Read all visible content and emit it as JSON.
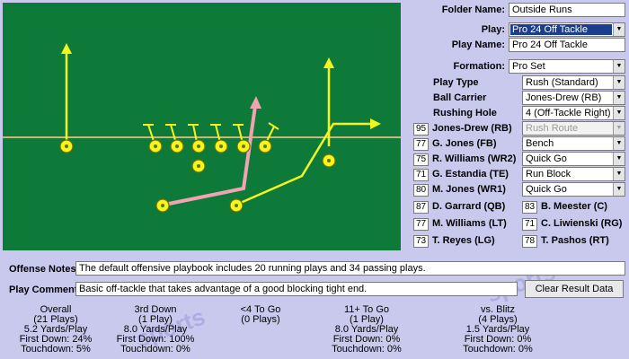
{
  "panel": {
    "folder_name_label": "Folder Name:",
    "folder_name_value": "Outside Runs",
    "play_label": "Play:",
    "play_value": "Pro 24 Off Tackle",
    "play_name_label": "Play Name:",
    "play_name_value": "Pro 24 Off Tackle",
    "formation_label": "Formation:",
    "formation_value": "Pro Set",
    "play_type_label": "Play Type",
    "play_type_value": "Rush (Standard)",
    "ball_carrier_label": "Ball Carrier",
    "ball_carrier_value": "Jones-Drew (RB)",
    "rushing_hole_label": "Rushing Hole",
    "rushing_hole_value": "4 (Off-Tackle Right)",
    "players": [
      {
        "num": "95",
        "name": "Jones-Drew (RB)",
        "assignment": "Rush Route"
      },
      {
        "num": "77",
        "name": "G. Jones (FB)",
        "assignment": "Bench"
      },
      {
        "num": "75",
        "name": "R. Williams (WR2)",
        "assignment": "Quick Go"
      },
      {
        "num": "71",
        "name": "G. Estandia (TE)",
        "assignment": "Run Block"
      },
      {
        "num": "80",
        "name": "M. Jones (WR1)",
        "assignment": "Quick Go"
      }
    ],
    "linemen": [
      {
        "num": "87",
        "name": "D. Garrard (QB)"
      },
      {
        "num": "83",
        "name": "B. Meester (C)"
      },
      {
        "num": "77",
        "name": "M. Williams (LT)"
      },
      {
        "num": "71",
        "name": "C. Liwienski (RG)"
      },
      {
        "num": "73",
        "name": "T. Reyes (LG)"
      },
      {
        "num": "78",
        "name": "T. Pashos (RT)"
      }
    ]
  },
  "notes": {
    "offense_label": "Offense Notes:",
    "offense_text": "The default offensive playbook includes 20 running plays and 34 passing plays.",
    "comment_label": "Play Comment:",
    "comment_text": "Basic off-tackle that takes advantage of a good blocking tight end.",
    "clear_button": "Clear Result Data"
  },
  "stats": [
    {
      "title": "Overall",
      "plays": "(21 Plays)",
      "ypp": "5.2 Yards/Play",
      "fd": "First Down: 24%",
      "td": "Touchdown: 5%"
    },
    {
      "title": "3rd Down",
      "plays": "(1 Play)",
      "ypp": "8.0 Yards/Play",
      "fd": "First Down: 100%",
      "td": "Touchdown: 0%"
    },
    {
      "title": "<4 To Go",
      "plays": "(0 Plays)",
      "ypp": "",
      "fd": "",
      "td": ""
    },
    {
      "title": "11+ To Go",
      "plays": "(1 Play)",
      "ypp": "8.0 Yards/Play",
      "fd": "First Down: 0%",
      "td": "Touchdown: 0%"
    },
    {
      "title": "vs. Blitz",
      "plays": "(4 Plays)",
      "ypp": "1.5 Yards/Play",
      "fd": "First Down: 0%",
      "td": "Touchdown: 0%"
    }
  ],
  "colors": {
    "background": "#c9c9ee",
    "field": "#0e7a3a",
    "player": "#f5f51e",
    "rush_route": "#f2a3b2",
    "selected_highlight": "#1b3f8e"
  }
}
